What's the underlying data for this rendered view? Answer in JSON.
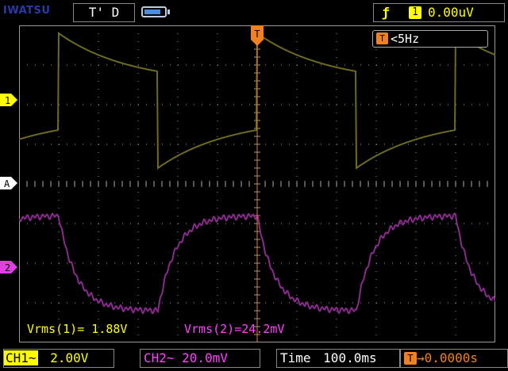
{
  "header": {
    "brand": "IWATSU",
    "run_state": "T' D",
    "battery_level": 0.85,
    "trigger": {
      "edge_icon": "rising-edge-icon",
      "source": "1",
      "level": "0.00uV"
    }
  },
  "frequency": {
    "marker": "T",
    "value": "<5Hz"
  },
  "markers": {
    "ch1": "1",
    "ch2": "2",
    "math": "A",
    "trigger_position": "T"
  },
  "measurements": {
    "ch1": "Vrms(1)= 1.88V",
    "ch2": "Vrms(2)=24.2mV"
  },
  "footer": {
    "ch1_tag": "CH1",
    "ch1_coupling": "~",
    "ch1_scale": "2.00V",
    "ch2_label": "CH2~ 20.0mV",
    "time_label": "Time",
    "time_scale": "100.0ms",
    "trig_tag": "T",
    "trig_offset": "→0.0000s"
  },
  "colors": {
    "ch1": "#6e6a1e",
    "ch2": "#8a2a8e",
    "ch1_label": "#ffff00",
    "ch2_label": "#ff40ff",
    "trigger": "#f08020",
    "grid": "#9a9a9a"
  }
}
